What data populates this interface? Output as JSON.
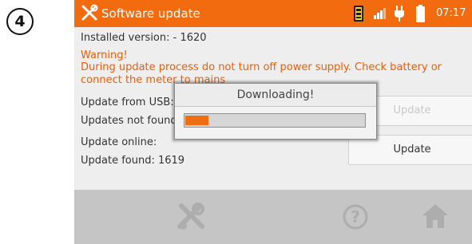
{
  "step_number": "4",
  "window": {
    "title": "Software update",
    "title_icon": "wrench-screwdriver-icon",
    "clock": "07:17"
  },
  "status_icons": [
    "sd-card-icon",
    "signal-strength-icon",
    "power-plug-icon",
    "battery-icon"
  ],
  "content": {
    "installed_version": "Installed version: - 1620",
    "warning_title": "Warning!",
    "warning_line1": "During update process do not turn off power supply. Check battery or",
    "warning_line2": "connect the meter to mains",
    "usb_label": "Update from USB:",
    "usb_status": "Updates not found",
    "online_label": "Update online:",
    "online_status": "Update found: 1619"
  },
  "buttons": {
    "update_usb": "Update",
    "update_online": "Update"
  },
  "dialog": {
    "title": "Downloading!",
    "progress": 0.13
  },
  "bottombar": {
    "icons": [
      "settings-tools-icon",
      "help-icon",
      "home-icon"
    ]
  },
  "colors": {
    "accent": "#f26b0f",
    "warning": "#e8600a",
    "bottom_bar": "#c5c5c5"
  }
}
